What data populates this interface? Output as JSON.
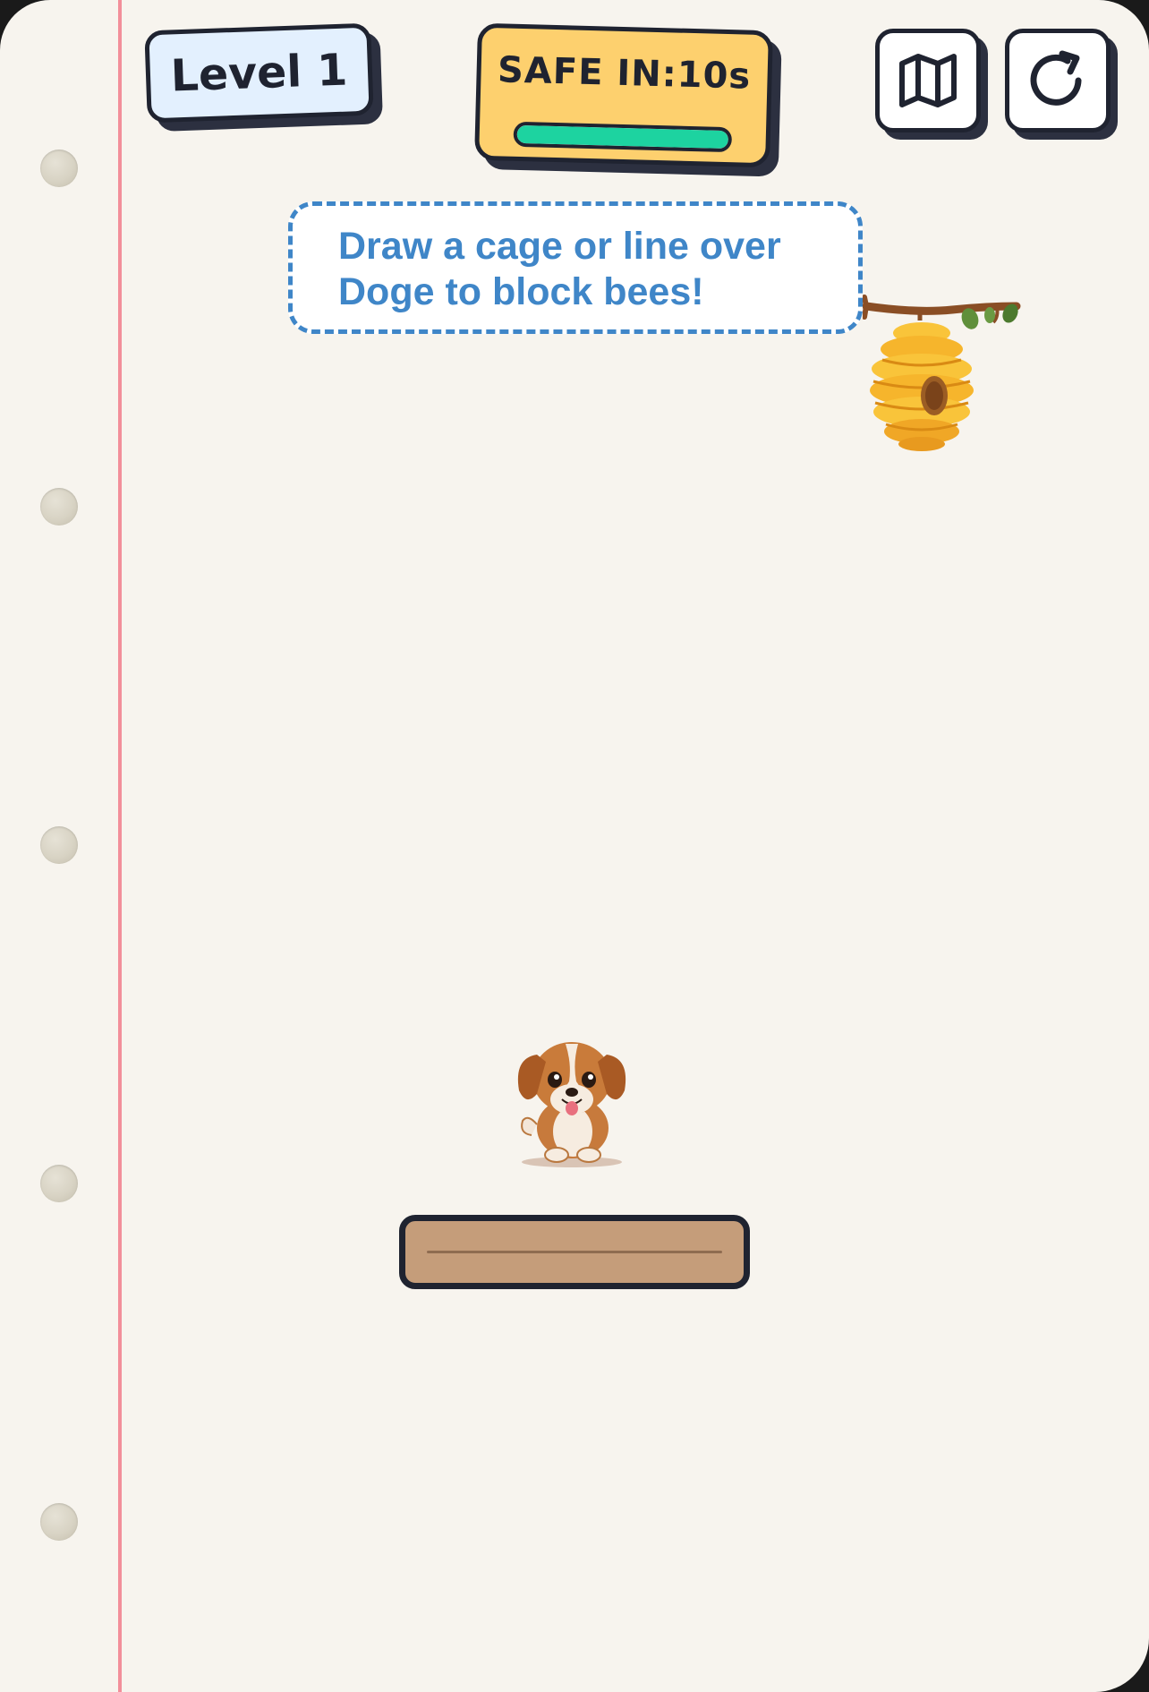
{
  "hud": {
    "level_label": "Level 1",
    "timer_label": "SAFE IN:",
    "timer_seconds": "10s",
    "timer_progress": 1.0
  },
  "buttons": {
    "map_icon": "map-icon",
    "restart_icon": "restart-icon"
  },
  "hint": {
    "line1": "Draw a cage or line over",
    "line2": "Doge to block bees!"
  },
  "colors": {
    "paper": "#f7f4ee",
    "margin_line": "#f28f9a",
    "level_badge": "#e3f0fe",
    "timer_badge": "#fdd06e",
    "timer_fill": "#1dd3a0",
    "hint_text": "#3f86c8",
    "platform": "#c59d7a",
    "outline": "#1f2330"
  }
}
